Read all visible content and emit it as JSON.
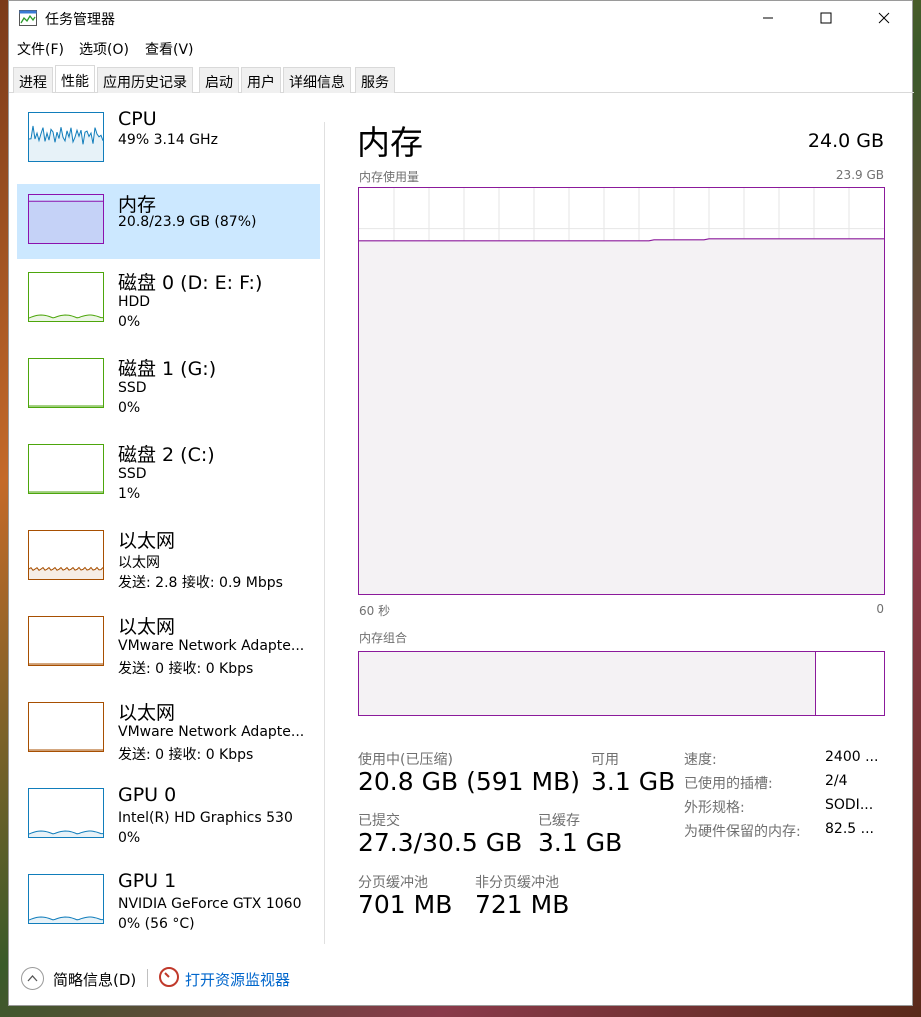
{
  "window": {
    "title": "任务管理器"
  },
  "menu": {
    "file": "文件(F)",
    "options": "选项(O)",
    "view": "查看(V)"
  },
  "tabs": [
    "进程",
    "性能",
    "应用历史记录",
    "启动",
    "用户",
    "详细信息",
    "服务"
  ],
  "active_tab_index": 1,
  "sidebar": [
    {
      "title": "CPU",
      "line1": "49% 3.14 GHz",
      "line2": "",
      "color": "#117dbb",
      "selected": false
    },
    {
      "title": "内存",
      "line1": "20.8/23.9 GB (87%)",
      "line2": "",
      "color": "#8b12ae",
      "selected": true
    },
    {
      "title": "磁盘 0 (D: E: F:)",
      "line1": "HDD",
      "line2": "0%",
      "color": "#4da60c",
      "selected": false
    },
    {
      "title": "磁盘 1 (G:)",
      "line1": "SSD",
      "line2": "0%",
      "color": "#4da60c",
      "selected": false
    },
    {
      "title": "磁盘 2 (C:)",
      "line1": "SSD",
      "line2": "1%",
      "color": "#4da60c",
      "selected": false
    },
    {
      "title": "以太网",
      "line1": "以太网",
      "line2": "发送: 2.8 接收: 0.9 Mbps",
      "color": "#a74f01",
      "selected": false
    },
    {
      "title": "以太网",
      "line1": "VMware Network Adapte...",
      "line2": "发送: 0 接收: 0 Kbps",
      "color": "#a74f01",
      "selected": false
    },
    {
      "title": "以太网",
      "line1": "VMware Network Adapte...",
      "line2": "发送: 0 接收: 0 Kbps",
      "color": "#a74f01",
      "selected": false
    },
    {
      "title": "GPU 0",
      "line1": "Intel(R) HD Graphics 530",
      "line2": "0%",
      "color": "#117dbb",
      "selected": false
    },
    {
      "title": "GPU 1",
      "line1": "NVIDIA GeForce GTX 1060",
      "line2": "0% (56 °C)",
      "color": "#117dbb",
      "selected": false
    }
  ],
  "main": {
    "title": "内存",
    "total": "24.0 GB",
    "usage_label": "内存使用量",
    "usage_max": "23.9 GB",
    "time_left": "60 秒",
    "time_right": "0",
    "composition_label": "内存组合",
    "usage_fraction": 0.87,
    "composition_used_fraction": 0.87
  },
  "stats": {
    "in_use_label": "使用中(已压缩)",
    "in_use_value": "20.8 GB (591 MB)",
    "available_label": "可用",
    "available_value": "3.1 GB",
    "committed_label": "已提交",
    "committed_value": "27.3/30.5 GB",
    "cached_label": "已缓存",
    "cached_value": "3.1 GB",
    "paged_label": "分页缓冲池",
    "paged_value": "701 MB",
    "nonpaged_label": "非分页缓冲池",
    "nonpaged_value": "721 MB"
  },
  "details": {
    "speed_label": "速度:",
    "speed_value": "2400 ...",
    "slots_label": "已使用的插槽:",
    "slots_value": "2/4",
    "form_label": "外形规格:",
    "form_value": "SODI...",
    "reserved_label": "为硬件保留的内存:",
    "reserved_value": "82.5 ..."
  },
  "footer": {
    "fewer_details": "简略信息(D)",
    "open_monitor": "打开资源监视器"
  }
}
